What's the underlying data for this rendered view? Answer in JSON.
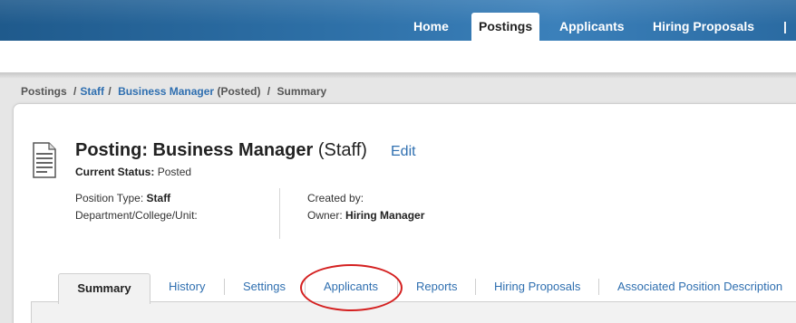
{
  "nav": {
    "items": [
      {
        "label": "Home",
        "active": false
      },
      {
        "label": "Postings",
        "active": true
      },
      {
        "label": "Applicants",
        "active": false
      },
      {
        "label": "Hiring Proposals",
        "active": false
      }
    ],
    "separator": "|"
  },
  "breadcrumb": {
    "postings": "Postings",
    "staff": "Staff",
    "posting_name": "Business Manager",
    "posting_state": "(Posted)",
    "current": "Summary",
    "sep": "/"
  },
  "posting": {
    "title_prefix": "Posting: Business Manager",
    "title_suffix": "(Staff)",
    "edit_label": "Edit",
    "status_label": "Current Status:",
    "status_value": "Posted",
    "position_type_label": "Position Type:",
    "position_type_value": "Staff",
    "department_label": "Department/College/Unit:",
    "created_by_label": "Created by:",
    "owner_label": "Owner:",
    "owner_value": "Hiring Manager"
  },
  "tabs": [
    {
      "label": "Summary",
      "active": true
    },
    {
      "label": "History"
    },
    {
      "label": "Settings"
    },
    {
      "label": "Applicants",
      "highlighted": true
    },
    {
      "label": "Reports"
    },
    {
      "label": "Hiring Proposals"
    },
    {
      "label": "Associated Position Description"
    }
  ],
  "colors": {
    "link": "#2f6fb0",
    "nav_bg": "#2d6fa6",
    "highlight_circle": "#d42020"
  },
  "icons": {
    "posting_icon": "document-icon"
  }
}
